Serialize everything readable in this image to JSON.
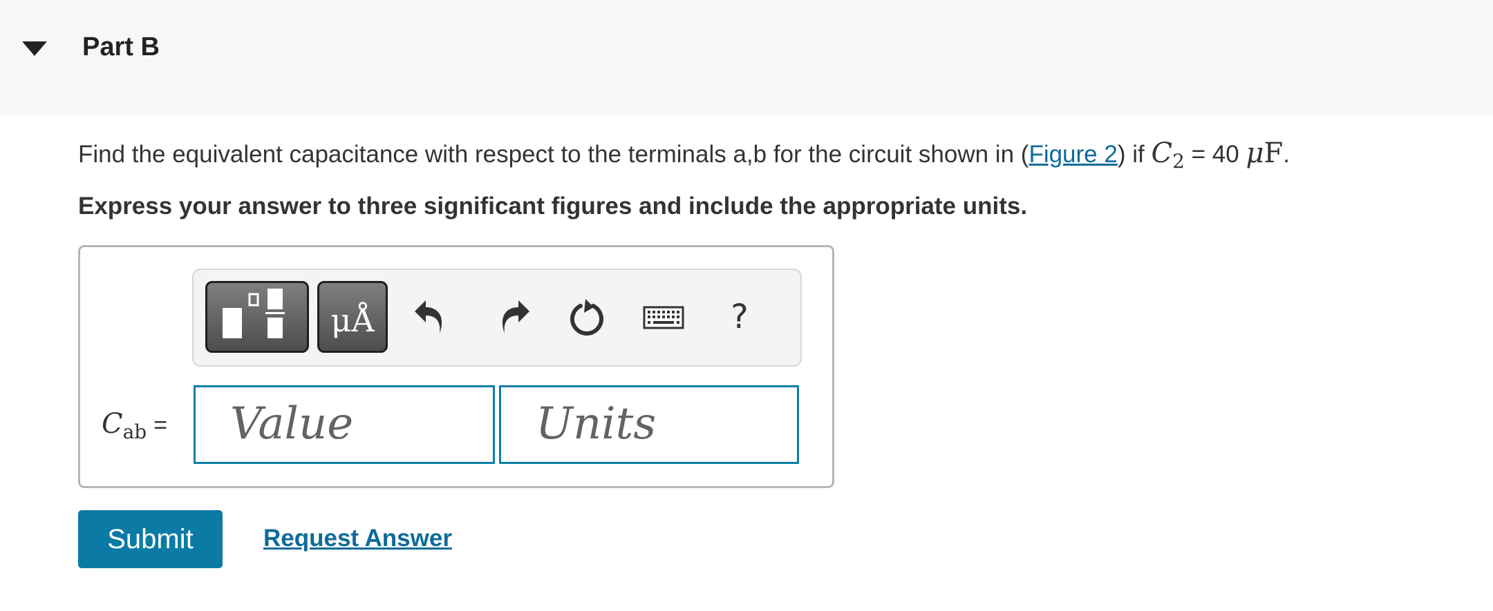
{
  "header": {
    "part_title": "Part B",
    "toggle_icon": "caret-down-icon"
  },
  "question": {
    "text_before": "Find the equivalent capacitance with respect to the terminals a,b for the circuit shown in (",
    "figure_link": "Figure 2",
    "text_after": ") if ",
    "var_symbol": "C",
    "var_subscript": "2",
    "equals_value": " = 40 ",
    "unit_prefix": "μ",
    "unit": "F",
    "end": "."
  },
  "instruction": "Express your answer to three significant figures and include the appropriate units.",
  "toolbar": {
    "units_button_label": "μÅ",
    "icons": [
      "template-icon",
      "units-icon",
      "undo-icon",
      "redo-icon",
      "reset-icon",
      "keyboard-icon",
      "help-icon"
    ],
    "help_label": "?"
  },
  "answer": {
    "label_symbol": "C",
    "label_subscript": "ab",
    "label_equals": "=",
    "value_placeholder": "Value",
    "units_placeholder": "Units"
  },
  "actions": {
    "submit_label": "Submit",
    "request_label": "Request Answer"
  },
  "colors": {
    "accent": "#0b7ba6",
    "link": "#0e6b99",
    "header_bg": "#f7f7f7"
  }
}
